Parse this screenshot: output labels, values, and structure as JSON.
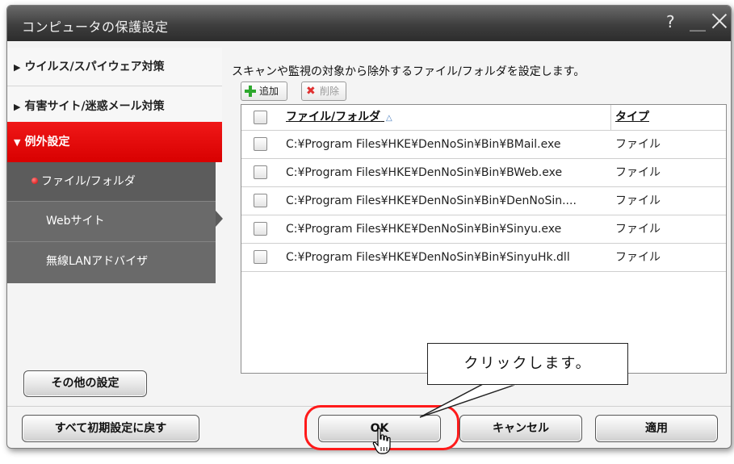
{
  "window": {
    "title": "コンピュータの保護設定",
    "help_label": "?",
    "minimize_label": "＿"
  },
  "sidebar": {
    "categories": [
      {
        "label": "ウイルス/スパイウェア対策",
        "expanded": false
      },
      {
        "label": "有害サイト/迷惑メール対策",
        "expanded": false
      },
      {
        "label": "例外設定",
        "expanded": true
      }
    ],
    "expanded_arrow": "▼",
    "collapsed_arrow": "▶",
    "subitems": [
      {
        "label": "ファイル/フォルダ",
        "selected": true
      },
      {
        "label": "Webサイト",
        "selected": false
      },
      {
        "label": "無線LANアドバイザ",
        "selected": false
      }
    ],
    "other_settings_label": "その他の設定",
    "reset_all_label": "すべて初期設定に戻す"
  },
  "main": {
    "description": "スキャンや監視の対象から除外するファイル/フォルダを設定します。",
    "toolbar": {
      "add_label": "追加",
      "delete_label": "削除",
      "delete_enabled": false
    },
    "table": {
      "columns": {
        "name": "ファイル/フォルダ",
        "type": "タイプ"
      },
      "sort_indicator": "△",
      "rows": [
        {
          "name": "C:¥Program Files¥HKE¥DenNoSin¥Bin¥BMail.exe",
          "type": "ファイル",
          "checked": false
        },
        {
          "name": "C:¥Program Files¥HKE¥DenNoSin¥Bin¥BWeb.exe",
          "type": "ファイル",
          "checked": false
        },
        {
          "name": "C:¥Program Files¥HKE¥DenNoSin¥Bin¥DenNoSin....",
          "type": "ファイル",
          "checked": false
        },
        {
          "name": "C:¥Program Files¥HKE¥DenNoSin¥Bin¥Sinyu.exe",
          "type": "ファイル",
          "checked": false
        },
        {
          "name": "C:¥Program Files¥HKE¥DenNoSin¥Bin¥SinyuHk.dll",
          "type": "ファイル",
          "checked": false
        }
      ]
    }
  },
  "footer": {
    "ok_label": "OK",
    "cancel_label": "キャンセル",
    "apply_label": "適用"
  },
  "annotation": {
    "callout_text": "クリックします。"
  },
  "colors": {
    "accent_red": "#e00000",
    "titlebar": "#3e3e3e",
    "subpanel": "#6a6a6a",
    "highlight_ring": "#ff1a1a"
  },
  "icons": {
    "add": "plus-icon",
    "delete": "x-icon",
    "close": "close-icon",
    "cursor": "hand-pointer-icon"
  }
}
